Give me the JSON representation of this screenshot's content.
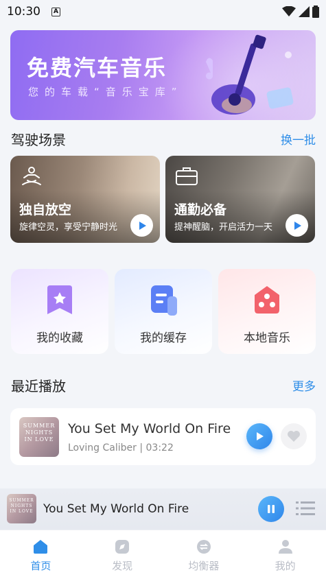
{
  "status_bar": {
    "time": "10:30",
    "notification_glyph": "A"
  },
  "banner": {
    "title": "免费汽车音乐",
    "subtitle": "您的车载“音乐宝库”"
  },
  "scenes_section": {
    "title": "驾驶场景",
    "action": "换一批"
  },
  "scenes": [
    {
      "title": "独自放空",
      "desc": "旋律空灵，享受宁静时光",
      "icon": "meditation-icon"
    },
    {
      "title": "通勤必备",
      "desc": "提神醒脑，开启活力一天",
      "icon": "briefcase-icon"
    }
  ],
  "quick_links": [
    {
      "label": "我的收藏",
      "icon": "favorites-icon",
      "color": "#9b6ff0"
    },
    {
      "label": "我的缓存",
      "icon": "cache-icon",
      "color": "#5b7ff5"
    },
    {
      "label": "本地音乐",
      "icon": "local-music-icon",
      "color": "#f2626b"
    }
  ],
  "recent_section": {
    "title": "最近播放",
    "action": "更多"
  },
  "recent_items": [
    {
      "title": "You Set My World On Fire",
      "meta": "Loving Caliber | 03:22",
      "cover_text": "SUMMER NIGHTS IN LOVE"
    }
  ],
  "now_playing": {
    "title": "You Set My World On Fire",
    "cover_text": "SUMMER NIGHTS IN LOVE"
  },
  "tabs": [
    {
      "label": "首页",
      "icon": "home-icon",
      "active": true
    },
    {
      "label": "发现",
      "icon": "discover-icon",
      "active": false
    },
    {
      "label": "均衡器",
      "icon": "equalizer-icon",
      "active": false
    },
    {
      "label": "我的",
      "icon": "profile-icon",
      "active": false
    }
  ],
  "colors": {
    "accent": "#2f8ee8",
    "banner_start": "#8f6cf2",
    "banner_end": "#dcc7f6"
  }
}
